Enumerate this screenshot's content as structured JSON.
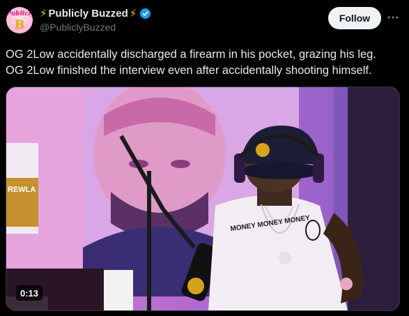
{
  "author": {
    "display_name": "Publicly Buzzed",
    "handle": "@PubliclyBuzzed",
    "avatar_text": "Publicly",
    "avatar_letter": "B",
    "verified": true
  },
  "follow_label": "Follow",
  "tweet": {
    "lines": [
      "OG 2Low accidentally discharged a firearm in his pocket, grazing his leg.",
      "OG 2Low finished the interview even after accidentally shooting himself."
    ]
  },
  "media": {
    "type": "video",
    "duration": "0:13",
    "mug_text": "MONEY MONEY MONEY",
    "jar_text": "REWLA"
  },
  "icons": {
    "name_prefix": "lightning-bolt-icon",
    "name_suffix": "lightning-bolt-icon",
    "verified": "verified-badge-icon",
    "more": "more-options-icon"
  },
  "colors": {
    "background": "#000000",
    "text_primary": "#e7e9ea",
    "text_secondary": "#71767b",
    "verified_blue": "#1d9bf0",
    "follow_button_bg": "#eff3f4",
    "bolt_yellow": "#f6c800"
  }
}
